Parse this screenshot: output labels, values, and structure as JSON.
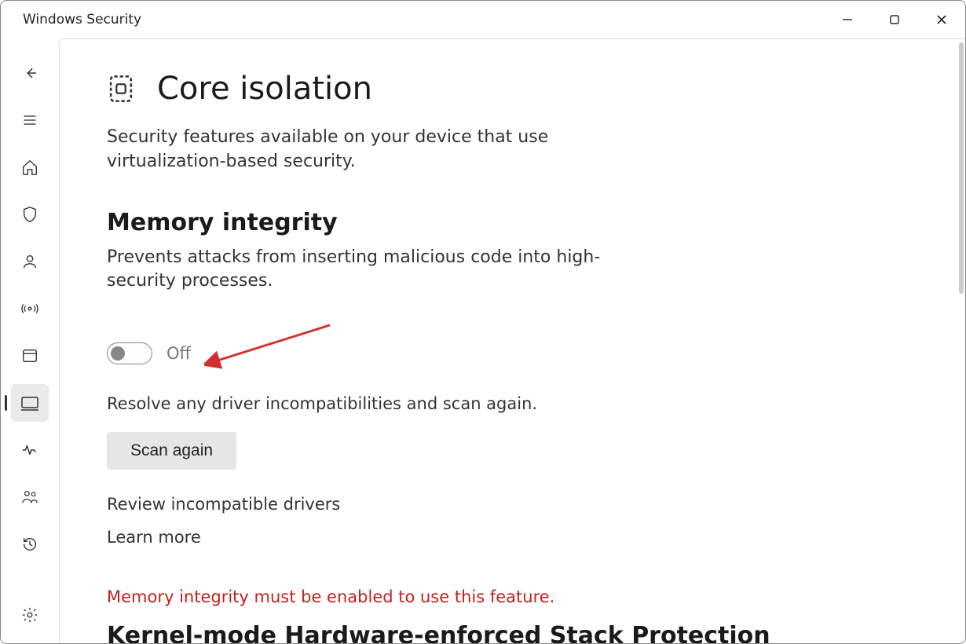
{
  "window": {
    "title": "Windows Security"
  },
  "page": {
    "title": "Core isolation",
    "subtitle": "Security features available on your device that use virtualization-based security."
  },
  "memory_integrity": {
    "title": "Memory integrity",
    "desc": "Prevents attacks from inserting malicious code into high-security processes.",
    "toggle_state": "Off",
    "resolve_text": "Resolve any driver incompatibilities and scan again.",
    "scan_button": "Scan again",
    "review_link": "Review incompatible drivers",
    "learn_link": "Learn more"
  },
  "kernel": {
    "warning": "Memory integrity must be enabled to use this feature.",
    "title": "Kernel-mode Hardware-enforced Stack Protection"
  }
}
